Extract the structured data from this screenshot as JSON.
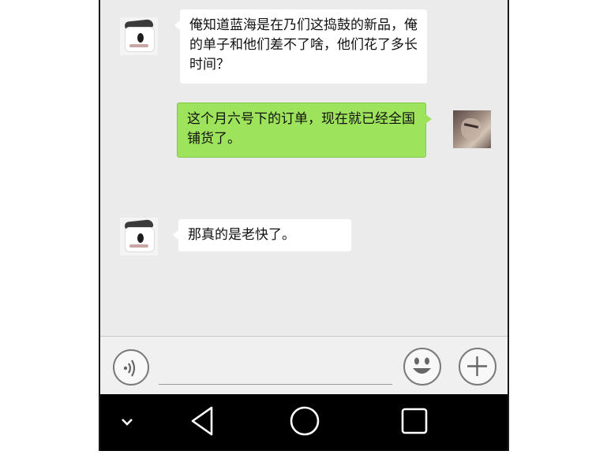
{
  "messages": [
    {
      "side": "left",
      "text": "俺知道蓝海是在乃们这捣鼓的新品，俺的单子和他们差不了啥，他们花了多长时间？"
    },
    {
      "side": "right",
      "text": "这个月六号下的订单，现在就已经全国铺货了。"
    },
    {
      "side": "left",
      "text": "那真的是老快了。"
    }
  ],
  "input_bar": {
    "voice_icon": "voice-icon",
    "emoji_icon": "emoji-icon",
    "plus_icon": "plus-icon",
    "text_value": ""
  },
  "nav_bar": {
    "icons": [
      "chevron-down-icon",
      "back-triangle-icon",
      "home-circle-icon",
      "recents-square-icon"
    ]
  },
  "colors": {
    "chat_background": "#ebebeb",
    "outgoing_bubble": "#9de35c",
    "incoming_bubble": "#ffffff",
    "nav_bar": "#000000"
  }
}
